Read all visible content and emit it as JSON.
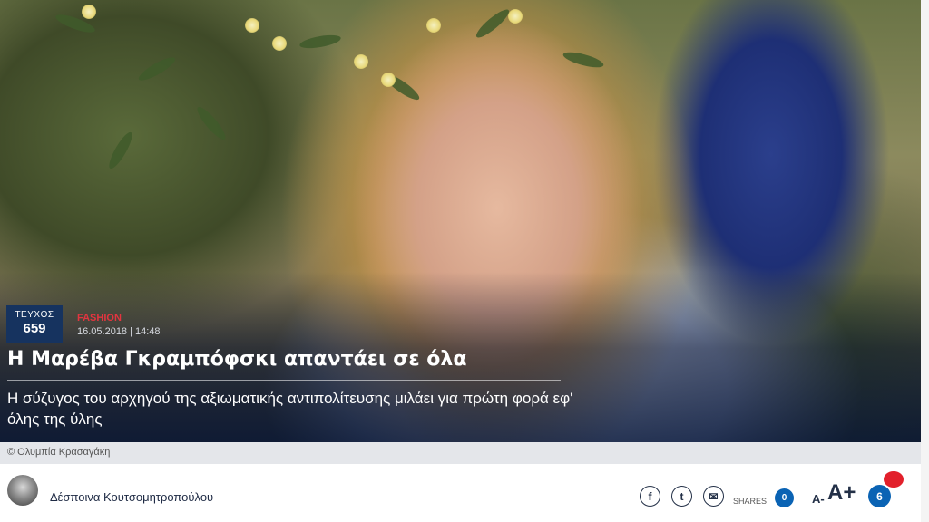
{
  "article": {
    "issue_label": "ΤΕΥΧΟΣ",
    "issue_number": "659",
    "category": "FASHION",
    "date": "16.05.2018 | 14:48",
    "title": "Η Μαρέβα Γκραμπόφσκι απαντάει σε όλα",
    "subtitle": "Η σύζυγος του αρχηγού της αξιωματικής αντιπολίτευσης μιλάει για πρώτη φορά εφ' όλης της ύλης",
    "photo_credit": "© Ολυμπία Κρασαγάκη"
  },
  "author": {
    "name": "Δέσποινα Κουτσομητροπούλου"
  },
  "share": {
    "facebook_glyph": "f",
    "twitter_glyph": "t",
    "email_glyph": "✉",
    "shares_label": "SHARES",
    "shares_count": "0"
  },
  "font_size": {
    "decrease_label": "A-",
    "increase_label": "A+"
  },
  "comments": {
    "count": "6"
  },
  "colors": {
    "issue_bg": "#16335f",
    "category": "#e2353f",
    "accent_blue": "#0a63b4",
    "notification_red": "#e2202b"
  }
}
